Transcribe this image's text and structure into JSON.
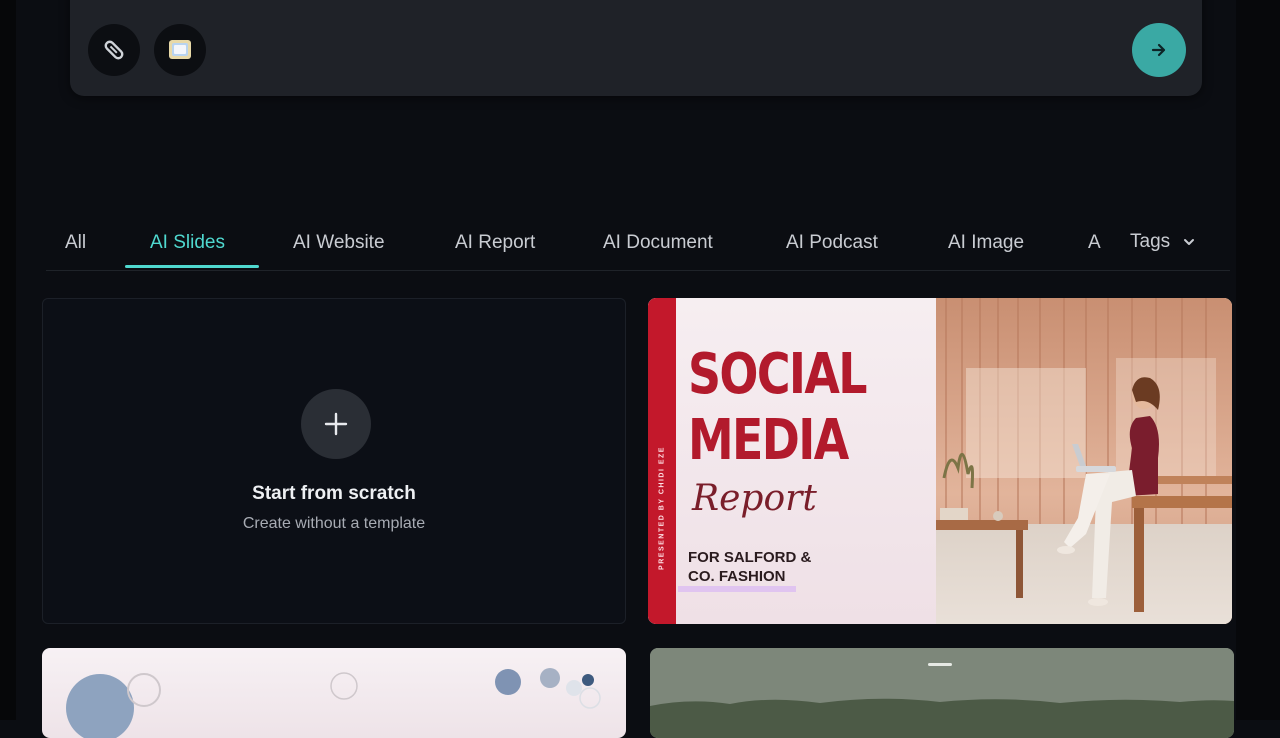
{
  "composer": {
    "icons": [
      "paperclip-icon",
      "image-icon",
      "arrow-right-icon"
    ],
    "colors": {
      "send": "#3aa9a4",
      "panel": "#1f2228"
    }
  },
  "tabs": {
    "items": [
      "All",
      "AI Slides",
      "AI Website",
      "AI Report",
      "AI Document",
      "AI Podcast",
      "AI Image"
    ],
    "overflow_fragment": "A",
    "active": "AI Slides",
    "tags_label": "Tags",
    "accent": "#4fd8cf"
  },
  "scratch_card": {
    "title": "Start from scratch",
    "subtitle": "Create without a template"
  },
  "template_card": {
    "vertical_text": "PRESENTED BY CHIDI EZE",
    "title_line1": "SOCIAL",
    "title_line2": "MEDIA",
    "script": "Report",
    "subtitle_line1": "FOR SALFORD &",
    "subtitle_line2": "CO. FASHION",
    "accent": "#b21a2c"
  }
}
